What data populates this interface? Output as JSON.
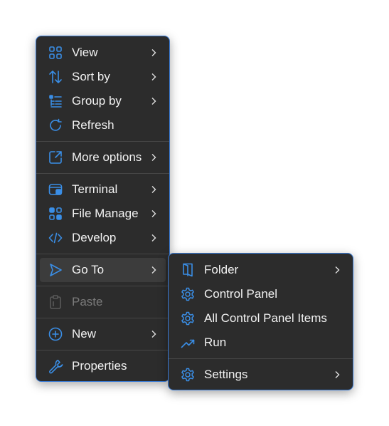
{
  "main_menu": {
    "items": [
      {
        "label": "View"
      },
      {
        "label": "Sort by"
      },
      {
        "label": "Group by"
      },
      {
        "label": "Refresh"
      },
      {
        "label": "More options"
      },
      {
        "label": "Terminal"
      },
      {
        "label": "File Manage"
      },
      {
        "label": "Develop"
      },
      {
        "label": "Go To"
      },
      {
        "label": "Paste"
      },
      {
        "label": "New"
      },
      {
        "label": "Properties"
      }
    ]
  },
  "sub_menu": {
    "items": [
      {
        "label": "Folder"
      },
      {
        "label": "Control Panel"
      },
      {
        "label": "All Control Panel Items"
      },
      {
        "label": "Run"
      },
      {
        "label": "Settings"
      }
    ]
  },
  "colors": {
    "menu_background": "#2c2c2c",
    "border_accent": "#3a7bd5",
    "icon_blue": "#3a8ee6",
    "text": "#f2f2f2",
    "disabled_text": "#7a7a7a"
  }
}
